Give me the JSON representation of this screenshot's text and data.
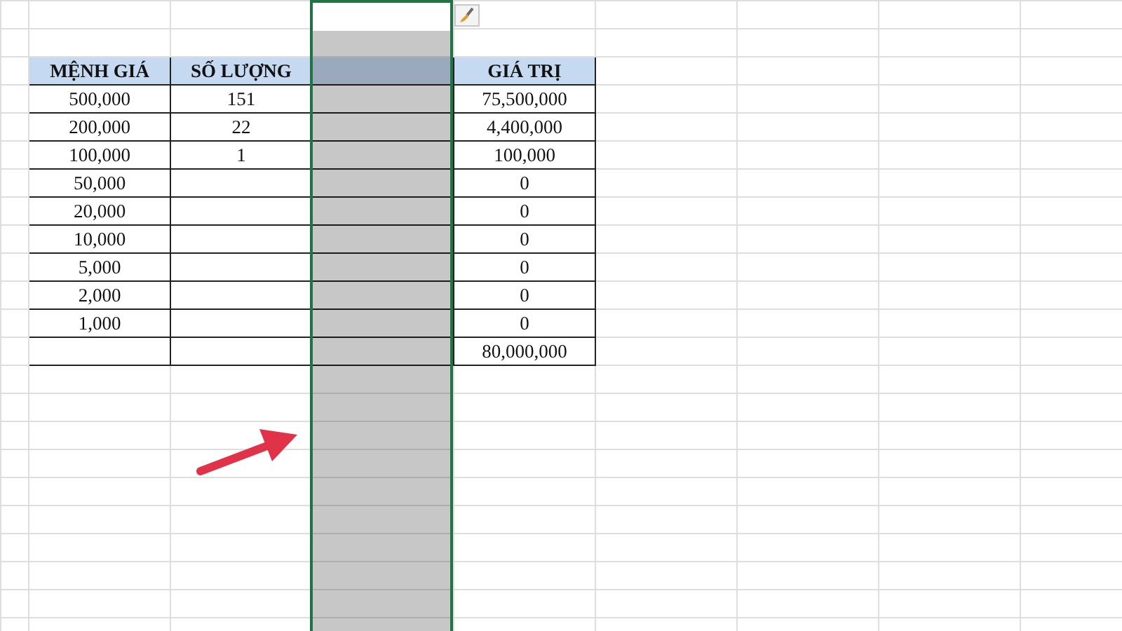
{
  "table": {
    "columns": [
      {
        "label": "MỆNH GIÁ",
        "selected": false
      },
      {
        "label": "SỐ LƯỢNG",
        "selected": false
      },
      {
        "selected": true
      },
      {
        "label": "GIÁ TRỊ",
        "selected": false
      }
    ],
    "rows": [
      {
        "menh_gia": "500,000",
        "so_luong": "151",
        "gia_tri": "75,500,000"
      },
      {
        "menh_gia": "200,000",
        "so_luong": "22",
        "gia_tri": "4,400,000"
      },
      {
        "menh_gia": "100,000",
        "so_luong": "1",
        "gia_tri": "100,000"
      },
      {
        "menh_gia": "50,000",
        "gia_tri": "0"
      },
      {
        "menh_gia": "20,000",
        "gia_tri": "0"
      },
      {
        "menh_gia": "10,000",
        "gia_tri": "0"
      },
      {
        "menh_gia": "5,000",
        "gia_tri": "0"
      },
      {
        "menh_gia": "2,000",
        "gia_tri": "0"
      },
      {
        "menh_gia": "1,000",
        "gia_tri": "0"
      },
      {
        "gia_tri": "80,000,000"
      }
    ]
  }
}
